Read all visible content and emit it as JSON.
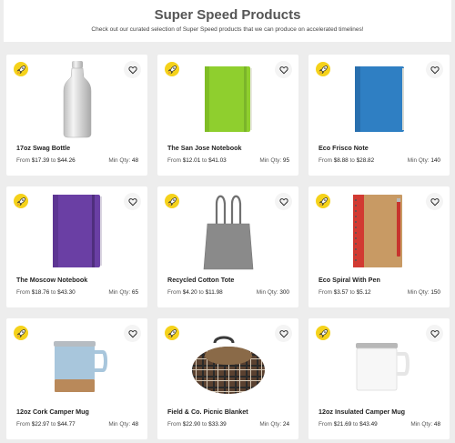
{
  "header": {
    "title": "Super Speed Products",
    "subtitle": "Check out our curated selection of Super Speed products that we can produce on accelerated timelines!"
  },
  "labels": {
    "from": "From",
    "to": "to",
    "min_qty": "Min Qty:"
  },
  "colors": {
    "badge": "#f5d21b",
    "card": "#ffffff",
    "page_bg": "#ededed"
  },
  "products": [
    {
      "name": "17oz Swag Bottle",
      "price_from": "$17.39",
      "price_to": "$44.26",
      "min_qty": "48",
      "image": "stainless-bottle",
      "badge_icon": "rocket-icon",
      "favorite_icon": "heart-icon"
    },
    {
      "name": "The San Jose Notebook",
      "price_from": "$12.01",
      "price_to": "$41.03",
      "min_qty": "95",
      "image": "lime-notebook",
      "badge_icon": "rocket-icon",
      "favorite_icon": "heart-icon"
    },
    {
      "name": "Eco Frisco Note",
      "price_from": "$8.88",
      "price_to": "$28.82",
      "min_qty": "140",
      "image": "blue-notebook",
      "badge_icon": "rocket-icon",
      "favorite_icon": "heart-icon"
    },
    {
      "name": "The Moscow Notebook",
      "price_from": "$18.76",
      "price_to": "$43.30",
      "min_qty": "65",
      "image": "purple-notebook",
      "badge_icon": "rocket-icon",
      "favorite_icon": "heart-icon"
    },
    {
      "name": "Recycled Cotton Tote",
      "price_from": "$4.20",
      "price_to": "$11.98",
      "min_qty": "300",
      "image": "gray-tote",
      "badge_icon": "rocket-icon",
      "favorite_icon": "heart-icon"
    },
    {
      "name": "Eco Spiral With Pen",
      "price_from": "$3.57",
      "price_to": "$5.12",
      "min_qty": "150",
      "image": "spiral-notebook-pen",
      "badge_icon": "rocket-icon",
      "favorite_icon": "heart-icon"
    },
    {
      "name": "12oz Cork Camper Mug",
      "price_from": "$22.97",
      "price_to": "$44.77",
      "min_qty": "48",
      "image": "cork-camper-mug",
      "badge_icon": "rocket-icon",
      "favorite_icon": "heart-icon"
    },
    {
      "name": "Field & Co. Picnic Blanket",
      "price_from": "$22.90",
      "price_to": "$33.39",
      "min_qty": "24",
      "image": "plaid-picnic-blanket",
      "badge_icon": "rocket-icon",
      "favorite_icon": "heart-icon"
    },
    {
      "name": "12oz Insulated Camper Mug",
      "price_from": "$21.69",
      "price_to": "$43.49",
      "min_qty": "48",
      "image": "white-camper-mug",
      "badge_icon": "rocket-icon",
      "favorite_icon": "heart-icon"
    }
  ]
}
